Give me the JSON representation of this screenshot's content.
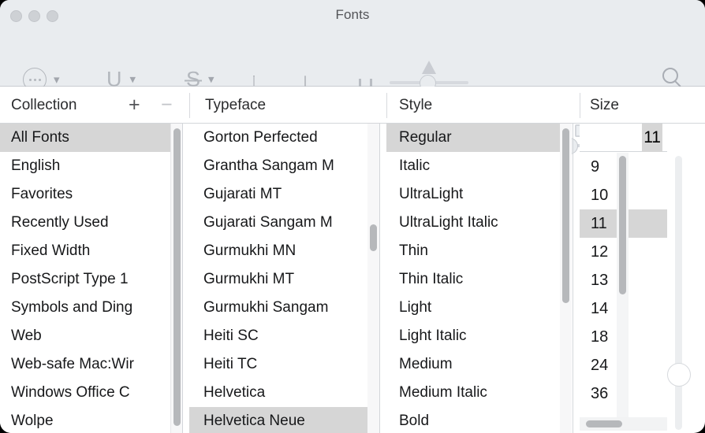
{
  "window": {
    "title": "Fonts",
    "traffic_lights": [
      "close-button",
      "minimize-button",
      "zoom-button"
    ]
  },
  "toolbar": {
    "items": [
      {
        "name": "text-effects-menu",
        "icon": "ellipsis-circle-icon",
        "label": ""
      },
      {
        "name": "underline-menu",
        "icon": "underline-icon",
        "label": "U"
      },
      {
        "name": "strikethrough-menu",
        "icon": "strikethrough-icon",
        "label": "S"
      },
      {
        "name": "text-color-swatch",
        "icon": "filled-square-icon",
        "label": ""
      },
      {
        "name": "document-color-swatch",
        "icon": "split-square-icon",
        "label": ""
      },
      {
        "name": "text-direction-button",
        "icon": "text-direction-icon",
        "label": ""
      },
      {
        "name": "shadow-opacity-slider",
        "icon": "triangle-cap-icon",
        "label": ""
      },
      {
        "name": "shadow-blur-slider",
        "icon": "solid-square-cap-icon",
        "label": ""
      },
      {
        "name": "shadow-offset-slider",
        "icon": "open-square-cap-icon",
        "label": ""
      },
      {
        "name": "search-button",
        "icon": "search-icon",
        "label": ""
      }
    ]
  },
  "headers": {
    "collection": "Collection",
    "add_label": "+",
    "remove_label": "−",
    "typeface": "Typeface",
    "style": "Style",
    "size": "Size"
  },
  "collection": {
    "items": [
      {
        "label": "All Fonts",
        "selected": true
      },
      {
        "label": "English",
        "selected": false
      },
      {
        "label": "Favorites",
        "selected": false
      },
      {
        "label": "Recently Used",
        "selected": false
      },
      {
        "label": "Fixed Width",
        "selected": false
      },
      {
        "label": "PostScript Type 1",
        "selected": false
      },
      {
        "label": "Symbols and Ding",
        "selected": false
      },
      {
        "label": "Web",
        "selected": false
      },
      {
        "label": "Web-safe Mac:Wir",
        "selected": false
      },
      {
        "label": "Windows Office C",
        "selected": false
      },
      {
        "label": "Wolpe",
        "selected": false
      }
    ]
  },
  "typeface": {
    "items": [
      {
        "label": "Gorton Perfected",
        "selected": false
      },
      {
        "label": "Grantha Sangam M",
        "selected": false
      },
      {
        "label": "Gujarati MT",
        "selected": false
      },
      {
        "label": "Gujarati Sangam M",
        "selected": false
      },
      {
        "label": "Gurmukhi MN",
        "selected": false
      },
      {
        "label": "Gurmukhi MT",
        "selected": false
      },
      {
        "label": "Gurmukhi Sangam",
        "selected": false
      },
      {
        "label": "Heiti SC",
        "selected": false
      },
      {
        "label": "Heiti TC",
        "selected": false
      },
      {
        "label": "Helvetica",
        "selected": false
      },
      {
        "label": "Helvetica Neue",
        "selected": true
      }
    ]
  },
  "style": {
    "items": [
      {
        "label": "Regular",
        "selected": true
      },
      {
        "label": "Italic",
        "selected": false
      },
      {
        "label": "UltraLight",
        "selected": false
      },
      {
        "label": "UltraLight Italic",
        "selected": false
      },
      {
        "label": "Thin",
        "selected": false
      },
      {
        "label": "Thin Italic",
        "selected": false
      },
      {
        "label": "Light",
        "selected": false
      },
      {
        "label": "Light Italic",
        "selected": false
      },
      {
        "label": "Medium",
        "selected": false
      },
      {
        "label": "Medium Italic",
        "selected": false
      },
      {
        "label": "Bold",
        "selected": false
      }
    ]
  },
  "size": {
    "value": "11",
    "items": [
      {
        "label": "9",
        "selected": false
      },
      {
        "label": "10",
        "selected": false
      },
      {
        "label": "11",
        "selected": true
      },
      {
        "label": "12",
        "selected": false
      },
      {
        "label": "13",
        "selected": false
      },
      {
        "label": "14",
        "selected": false
      },
      {
        "label": "18",
        "selected": false
      },
      {
        "label": "24",
        "selected": false
      },
      {
        "label": "36",
        "selected": false
      }
    ]
  },
  "colors": {
    "chrome": "#e9ecef",
    "selection": "#d6d6d6",
    "text": "#17181a",
    "title_text": "#535458",
    "divider": "#d3d6da",
    "scrollbar_thumb": "#b6b8bb"
  }
}
